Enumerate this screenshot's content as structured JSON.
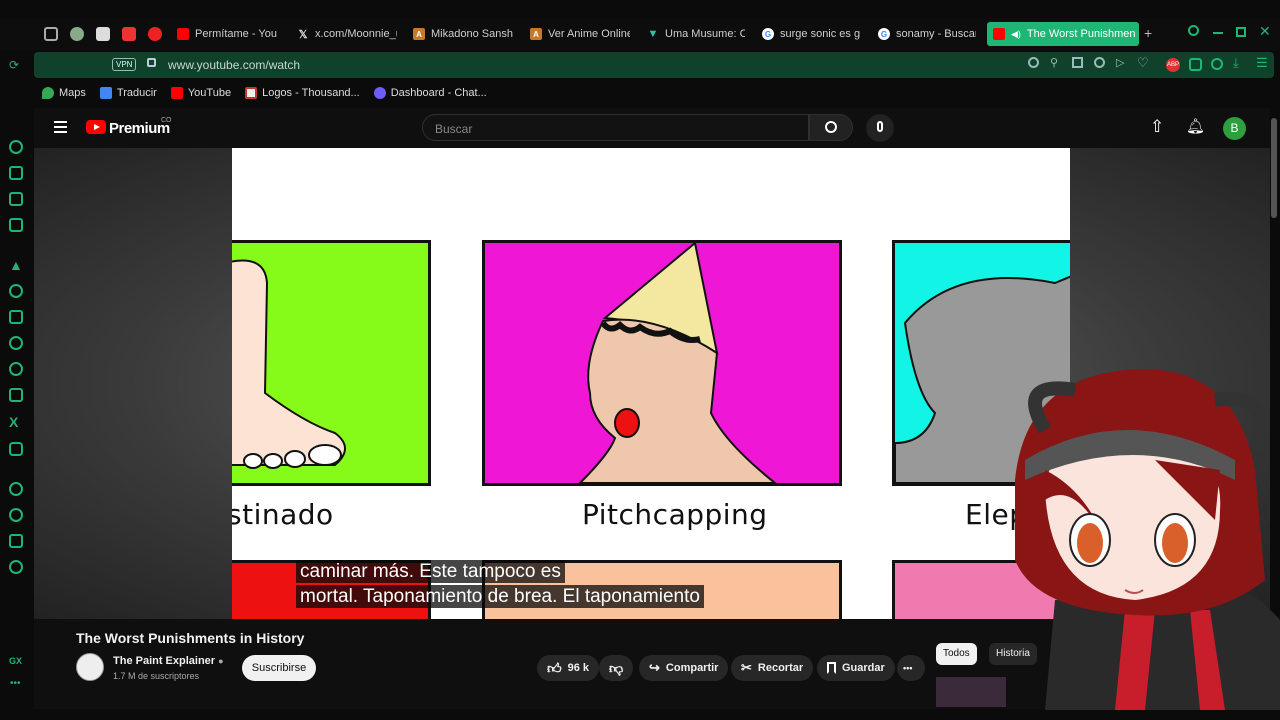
{
  "browser": {
    "tabs": [
      {
        "label": "Permítame - YouT",
        "color": "#ff0000"
      },
      {
        "label": "x.com/Moonnie_u",
        "color": "#000000"
      },
      {
        "label": "Mikadono Sanshi",
        "color": "#c57a2b"
      },
      {
        "label": "Ver Anime Online",
        "color": "#c57a2b"
      },
      {
        "label": "Uma Musume: Ci",
        "color": "#26c6a6"
      },
      {
        "label": "surge sonic es g",
        "color": "#4285f4"
      },
      {
        "label": "sonamy - Buscar",
        "color": "#4285f4"
      },
      {
        "label": "The Worst Punishmen",
        "color": "#ff0000"
      }
    ],
    "new_tab": "+",
    "address": {
      "vpn_label": "VPN",
      "url": "www.youtube.com/watch"
    },
    "bookmarks": [
      {
        "label": "Maps",
        "color": "#34a853"
      },
      {
        "label": "Traducir",
        "color": "#4285f4"
      },
      {
        "label": "YouTube",
        "color": "#ff0000"
      },
      {
        "label": "Logos - Thousand...",
        "color": "#c0392b"
      },
      {
        "label": "Dashboard - Chat...",
        "color": "#6d5dfc"
      }
    ],
    "sidebar_bottom": "GX"
  },
  "youtube": {
    "brand": "Premium",
    "region": "CO",
    "search_placeholder": "Buscar",
    "avatar_letter": "B",
    "video": {
      "captions": [
        "stinado",
        "Pitchcapping",
        "Elep"
      ],
      "subtitles": [
        "caminar más. Este tampoco es",
        "mortal. Taponamiento de brea. El taponamiento"
      ]
    },
    "title": "The Worst Punishments in History",
    "channel": {
      "name": "The Paint Explainer",
      "subs": "1.7 M de suscriptores",
      "subscribe_label": "Suscribirse"
    },
    "actions": {
      "likes": "96 k",
      "share": "Compartir",
      "clip": "Recortar",
      "save": "Guardar",
      "more": "•••"
    },
    "chips": [
      "Todos",
      "Historia"
    ]
  },
  "colors": {
    "accent": "#1fb574",
    "youtube_red": "#ff0000"
  }
}
